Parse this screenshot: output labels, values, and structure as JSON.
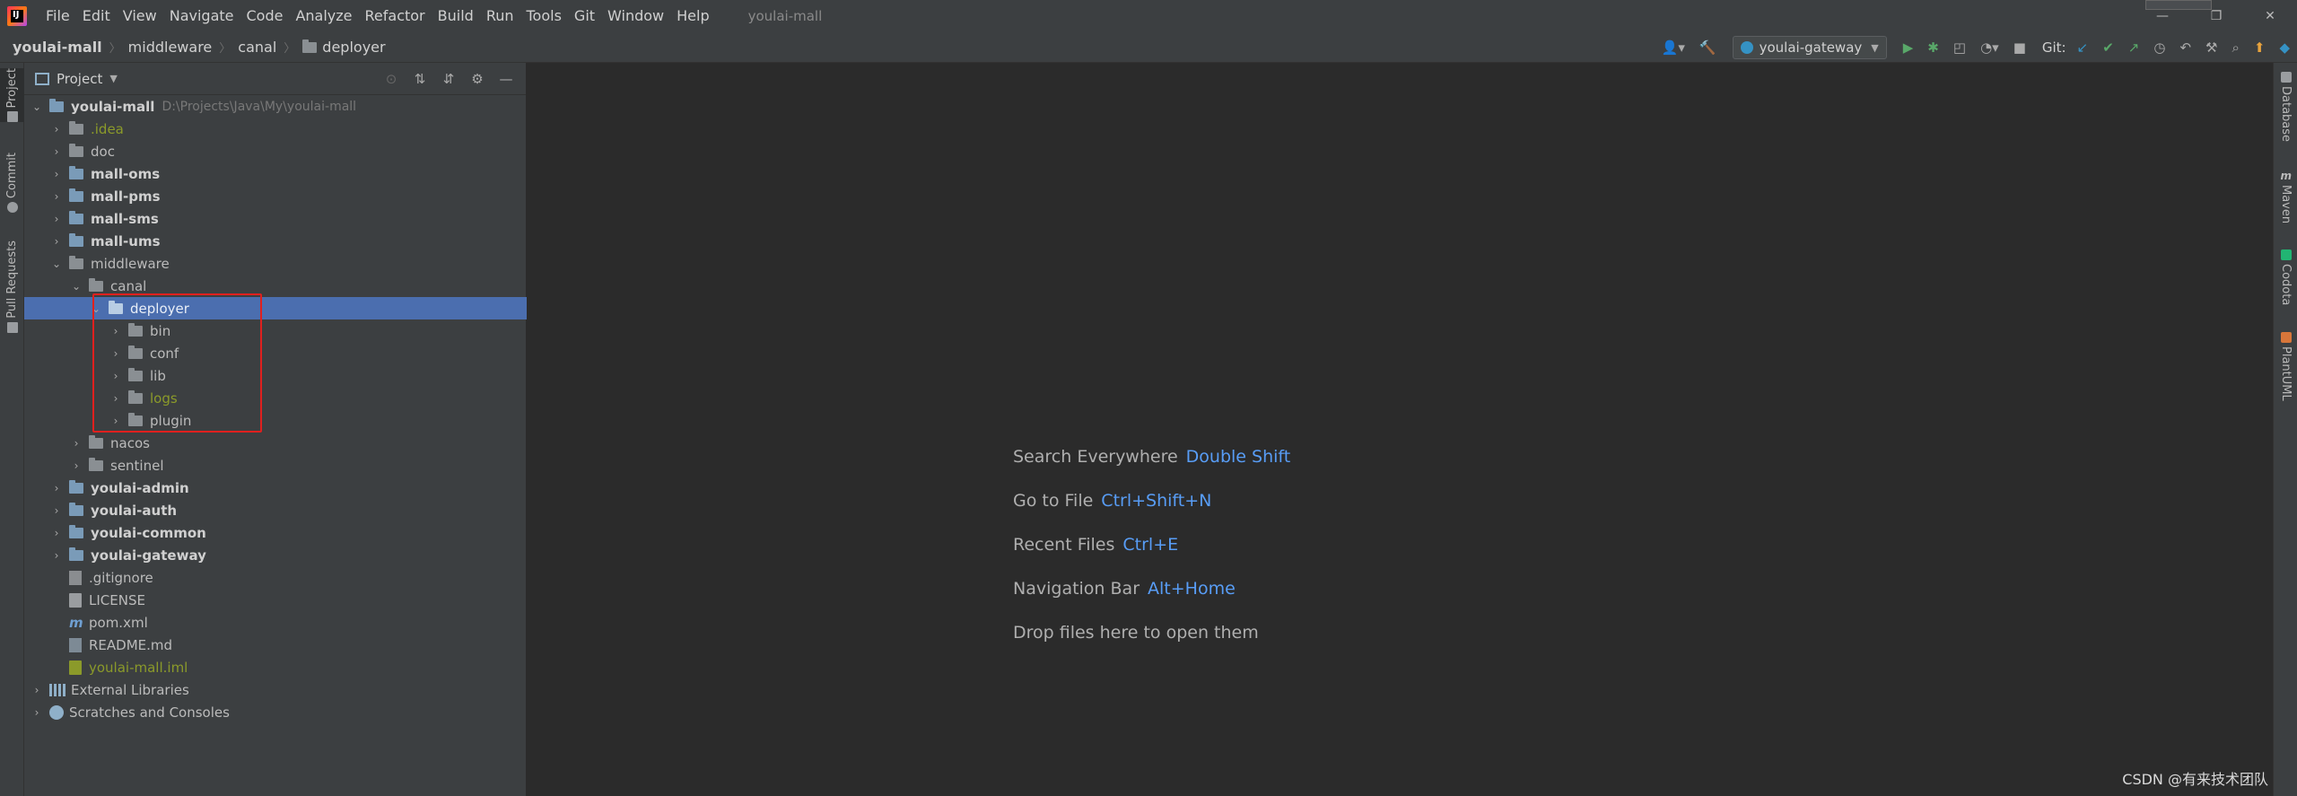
{
  "window": {
    "app_logo_text": "IJ",
    "title": "youlai-mall",
    "menu": [
      "File",
      "Edit",
      "View",
      "Navigate",
      "Code",
      "Analyze",
      "Refactor",
      "Build",
      "Run",
      "Tools",
      "Git",
      "Window",
      "Help"
    ],
    "minimize": "—",
    "restore": "❐",
    "close": "✕"
  },
  "navbar": {
    "breadcrumb": [
      "youlai-mall",
      "middleware",
      "canal",
      "deployer"
    ],
    "run_config": "youlai-gateway",
    "git_label": "Git:"
  },
  "left_stripe": {
    "tabs": [
      "Project",
      "Commit",
      "Pull Requests"
    ]
  },
  "right_stripe": {
    "tabs": [
      "Database",
      "Maven",
      "Codota",
      "PlantUML"
    ]
  },
  "project_panel": {
    "title": "Project",
    "root_path": "D:\\Projects\\Java\\My\\youlai-mall",
    "tree": [
      {
        "label": "youlai-mall",
        "depth": 0,
        "arrow": "⌄",
        "type": "root",
        "style": "bold"
      },
      {
        "label": ".idea",
        "depth": 1,
        "arrow": "›",
        "type": "folder",
        "style": "ign"
      },
      {
        "label": "doc",
        "depth": 1,
        "arrow": "›",
        "type": "folder",
        "style": "normal"
      },
      {
        "label": "mall-oms",
        "depth": 1,
        "arrow": "›",
        "type": "module",
        "style": "bold"
      },
      {
        "label": "mall-pms",
        "depth": 1,
        "arrow": "›",
        "type": "module",
        "style": "bold"
      },
      {
        "label": "mall-sms",
        "depth": 1,
        "arrow": "›",
        "type": "module",
        "style": "bold"
      },
      {
        "label": "mall-ums",
        "depth": 1,
        "arrow": "›",
        "type": "module",
        "style": "bold"
      },
      {
        "label": "middleware",
        "depth": 1,
        "arrow": "⌄",
        "type": "folder",
        "style": "normal"
      },
      {
        "label": "canal",
        "depth": 2,
        "arrow": "⌄",
        "type": "folder",
        "style": "normal"
      },
      {
        "label": "deployer",
        "depth": 3,
        "arrow": "⌄",
        "type": "folder",
        "style": "sel"
      },
      {
        "label": "bin",
        "depth": 4,
        "arrow": "›",
        "type": "folder",
        "style": "normal"
      },
      {
        "label": "conf",
        "depth": 4,
        "arrow": "›",
        "type": "folder",
        "style": "normal"
      },
      {
        "label": "lib",
        "depth": 4,
        "arrow": "›",
        "type": "folder",
        "style": "normal"
      },
      {
        "label": "logs",
        "depth": 4,
        "arrow": "›",
        "type": "folder",
        "style": "ign"
      },
      {
        "label": "plugin",
        "depth": 4,
        "arrow": "›",
        "type": "folder",
        "style": "normal"
      },
      {
        "label": "nacos",
        "depth": 2,
        "arrow": "›",
        "type": "folder",
        "style": "normal"
      },
      {
        "label": "sentinel",
        "depth": 2,
        "arrow": "›",
        "type": "folder",
        "style": "normal"
      },
      {
        "label": "youlai-admin",
        "depth": 1,
        "arrow": "›",
        "type": "module",
        "style": "bold"
      },
      {
        "label": "youlai-auth",
        "depth": 1,
        "arrow": "›",
        "type": "module",
        "style": "bold"
      },
      {
        "label": "youlai-common",
        "depth": 1,
        "arrow": "›",
        "type": "module",
        "style": "bold"
      },
      {
        "label": "youlai-gateway",
        "depth": 1,
        "arrow": "›",
        "type": "module",
        "style": "bold"
      },
      {
        "label": ".gitignore",
        "depth": 1,
        "arrow": "",
        "type": "git",
        "style": "normal"
      },
      {
        "label": "LICENSE",
        "depth": 1,
        "arrow": "",
        "type": "txt",
        "style": "normal"
      },
      {
        "label": "pom.xml",
        "depth": 1,
        "arrow": "",
        "type": "m",
        "style": "normal"
      },
      {
        "label": "README.md",
        "depth": 1,
        "arrow": "",
        "type": "md",
        "style": "normal"
      },
      {
        "label": "youlai-mall.iml",
        "depth": 1,
        "arrow": "",
        "type": "iml",
        "style": "ign"
      },
      {
        "label": "External Libraries",
        "depth": 0,
        "arrow": "›",
        "type": "lib",
        "style": "normal"
      },
      {
        "label": "Scratches and Consoles",
        "depth": 0,
        "arrow": "›",
        "type": "scratch",
        "style": "normal"
      }
    ]
  },
  "editor": {
    "hints": [
      {
        "label": "Search Everywhere",
        "shortcut": "Double Shift"
      },
      {
        "label": "Go to File",
        "shortcut": "Ctrl+Shift+N"
      },
      {
        "label": "Recent Files",
        "shortcut": "Ctrl+E"
      },
      {
        "label": "Navigation Bar",
        "shortcut": "Alt+Home"
      },
      {
        "label": "Drop files here to open them",
        "shortcut": ""
      }
    ]
  },
  "watermark": "CSDN @有来技术团队"
}
